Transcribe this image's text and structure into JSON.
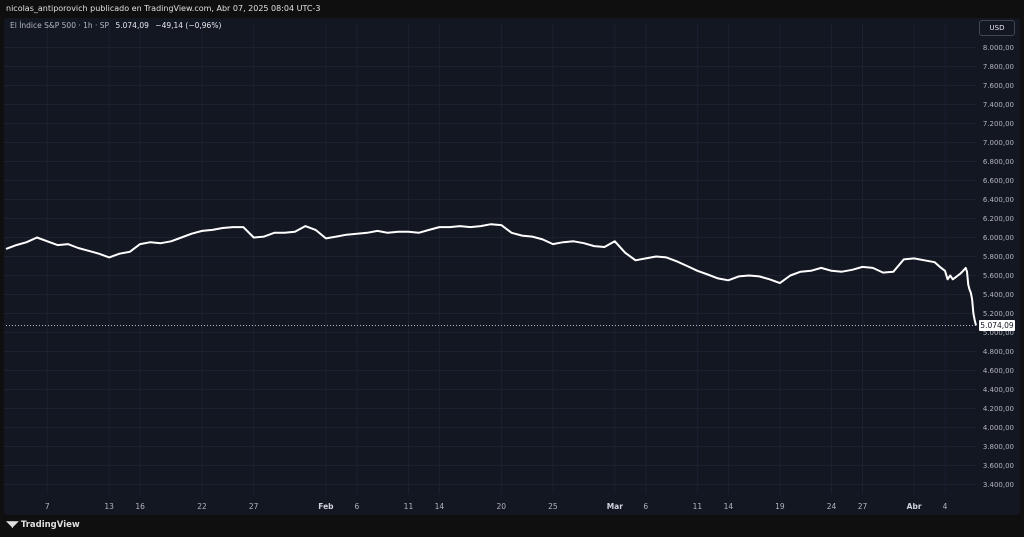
{
  "header": {
    "published_line": "nicolas_antiporovich publicado en TradingView.com, Abr 07, 2025 08:04 UTC-3"
  },
  "legend": {
    "symbol": "El Índice S&P 500 · 1h · SP",
    "last_value": "5.074,09",
    "change": "−49,14 (−0,96%)"
  },
  "toolbar": {
    "currency_label": "USD"
  },
  "footer": {
    "brand": "TradingView",
    "logo_icon": "tradingview-logo-icon"
  },
  "colors": {
    "background": "#131722",
    "line": "#ffffff",
    "grid": "#1e2230",
    "text": "#b2b5be"
  },
  "chart_data": {
    "type": "line",
    "title": "",
    "xlabel": "",
    "ylabel": "",
    "ylim": [
      3300,
      8100
    ],
    "grid": true,
    "y_axis_side": "right",
    "y_ticks": [
      {
        "value": 8000,
        "label": "8.000,00"
      },
      {
        "value": 7800,
        "label": "7.800,00"
      },
      {
        "value": 7600,
        "label": "7.600,00"
      },
      {
        "value": 7400,
        "label": "7.400,00"
      },
      {
        "value": 7200,
        "label": "7.200,00"
      },
      {
        "value": 7000,
        "label": "7.000,00"
      },
      {
        "value": 6800,
        "label": "6.800,00"
      },
      {
        "value": 6600,
        "label": "6.600,00"
      },
      {
        "value": 6400,
        "label": "6.400,00"
      },
      {
        "value": 6200,
        "label": "6.200,00"
      },
      {
        "value": 6000,
        "label": "6.000,00"
      },
      {
        "value": 5800,
        "label": "5.800,00"
      },
      {
        "value": 5600,
        "label": "5.600,00"
      },
      {
        "value": 5400,
        "label": "5.400,00"
      },
      {
        "value": 5200,
        "label": "5.200,00"
      },
      {
        "value": 5000,
        "label": "5.000,00"
      },
      {
        "value": 4800,
        "label": "4.800,00"
      },
      {
        "value": 4600,
        "label": "4.600,00"
      },
      {
        "value": 4400,
        "label": "4.400,00"
      },
      {
        "value": 4200,
        "label": "4.200,00"
      },
      {
        "value": 4000,
        "label": "4.000,00"
      },
      {
        "value": 3800,
        "label": "3.800,00"
      },
      {
        "value": 3600,
        "label": "3.600,00"
      },
      {
        "value": 3400,
        "label": "3.400,00"
      }
    ],
    "x_domain": [
      "2025-01-03",
      "2025-04-07"
    ],
    "x_ticks": [
      {
        "date": "2025-01-07",
        "label": "7",
        "bold": false
      },
      {
        "date": "2025-01-13",
        "label": "13",
        "bold": false
      },
      {
        "date": "2025-01-16",
        "label": "16",
        "bold": false
      },
      {
        "date": "2025-01-22",
        "label": "22",
        "bold": false
      },
      {
        "date": "2025-01-27",
        "label": "27",
        "bold": false
      },
      {
        "date": "2025-02-03",
        "label": "Feb",
        "bold": true
      },
      {
        "date": "2025-02-06",
        "label": "6",
        "bold": false
      },
      {
        "date": "2025-02-11",
        "label": "11",
        "bold": false
      },
      {
        "date": "2025-02-14",
        "label": "14",
        "bold": false
      },
      {
        "date": "2025-02-20",
        "label": "20",
        "bold": false
      },
      {
        "date": "2025-02-25",
        "label": "25",
        "bold": false
      },
      {
        "date": "2025-03-03",
        "label": "Mar",
        "bold": true
      },
      {
        "date": "2025-03-06",
        "label": "6",
        "bold": false
      },
      {
        "date": "2025-03-11",
        "label": "11",
        "bold": false
      },
      {
        "date": "2025-03-14",
        "label": "14",
        "bold": false
      },
      {
        "date": "2025-03-19",
        "label": "19",
        "bold": false
      },
      {
        "date": "2025-03-24",
        "label": "24",
        "bold": false
      },
      {
        "date": "2025-03-27",
        "label": "27",
        "bold": false
      },
      {
        "date": "2025-04-01",
        "label": "Abr",
        "bold": true
      },
      {
        "date": "2025-04-04",
        "label": "4",
        "bold": false
      }
    ],
    "last_price": {
      "value": 5074.09,
      "label": "5.074,09"
    },
    "series": [
      {
        "points": [
          [
            "2025-01-03",
            5880
          ],
          [
            "2025-01-04",
            5920
          ],
          [
            "2025-01-05",
            5950
          ],
          [
            "2025-01-06",
            6000
          ],
          [
            "2025-01-07",
            5960
          ],
          [
            "2025-01-08",
            5920
          ],
          [
            "2025-01-09",
            5930
          ],
          [
            "2025-01-10",
            5890
          ],
          [
            "2025-01-11",
            5860
          ],
          [
            "2025-01-12",
            5830
          ],
          [
            "2025-01-13",
            5790
          ],
          [
            "2025-01-14",
            5830
          ],
          [
            "2025-01-15",
            5850
          ],
          [
            "2025-01-16",
            5930
          ],
          [
            "2025-01-17",
            5950
          ],
          [
            "2025-01-18",
            5940
          ],
          [
            "2025-01-19",
            5960
          ],
          [
            "2025-01-20",
            6000
          ],
          [
            "2025-01-21",
            6040
          ],
          [
            "2025-01-22",
            6070
          ],
          [
            "2025-01-23",
            6080
          ],
          [
            "2025-01-24",
            6100
          ],
          [
            "2025-01-25",
            6110
          ],
          [
            "2025-01-26",
            6110
          ],
          [
            "2025-01-27",
            6000
          ],
          [
            "2025-01-28",
            6010
          ],
          [
            "2025-01-29",
            6050
          ],
          [
            "2025-01-30",
            6050
          ],
          [
            "2025-01-31",
            6060
          ],
          [
            "2025-02-01",
            6120
          ],
          [
            "2025-02-02",
            6080
          ],
          [
            "2025-02-03",
            5990
          ],
          [
            "2025-02-04",
            6010
          ],
          [
            "2025-02-05",
            6030
          ],
          [
            "2025-02-06",
            6040
          ],
          [
            "2025-02-07",
            6050
          ],
          [
            "2025-02-08",
            6070
          ],
          [
            "2025-02-09",
            6050
          ],
          [
            "2025-02-10",
            6060
          ],
          [
            "2025-02-11",
            6060
          ],
          [
            "2025-02-12",
            6050
          ],
          [
            "2025-02-13",
            6080
          ],
          [
            "2025-02-14",
            6110
          ],
          [
            "2025-02-15",
            6110
          ],
          [
            "2025-02-16",
            6120
          ],
          [
            "2025-02-17",
            6110
          ],
          [
            "2025-02-18",
            6120
          ],
          [
            "2025-02-19",
            6140
          ],
          [
            "2025-02-20",
            6130
          ],
          [
            "2025-02-21",
            6050
          ],
          [
            "2025-02-22",
            6020
          ],
          [
            "2025-02-23",
            6010
          ],
          [
            "2025-02-24",
            5980
          ],
          [
            "2025-02-25",
            5930
          ],
          [
            "2025-02-26",
            5950
          ],
          [
            "2025-02-27",
            5960
          ],
          [
            "2025-02-28",
            5940
          ],
          [
            "2025-03-01",
            5910
          ],
          [
            "2025-03-02",
            5900
          ],
          [
            "2025-03-03",
            5960
          ],
          [
            "2025-03-04",
            5840
          ],
          [
            "2025-03-05",
            5760
          ],
          [
            "2025-03-06",
            5780
          ],
          [
            "2025-03-07",
            5800
          ],
          [
            "2025-03-08",
            5790
          ],
          [
            "2025-03-09",
            5750
          ],
          [
            "2025-03-10",
            5700
          ],
          [
            "2025-03-11",
            5650
          ],
          [
            "2025-03-12",
            5610
          ],
          [
            "2025-03-13",
            5570
          ],
          [
            "2025-03-14",
            5550
          ],
          [
            "2025-03-15",
            5590
          ],
          [
            "2025-03-16",
            5600
          ],
          [
            "2025-03-17",
            5590
          ],
          [
            "2025-03-18",
            5560
          ],
          [
            "2025-03-19",
            5520
          ],
          [
            "2025-03-20",
            5600
          ],
          [
            "2025-03-21",
            5640
          ],
          [
            "2025-03-22",
            5650
          ],
          [
            "2025-03-23",
            5680
          ],
          [
            "2025-03-24",
            5650
          ],
          [
            "2025-03-25",
            5640
          ],
          [
            "2025-03-26",
            5660
          ],
          [
            "2025-03-27",
            5690
          ],
          [
            "2025-03-28",
            5680
          ],
          [
            "2025-03-29",
            5630
          ],
          [
            "2025-03-30",
            5640
          ],
          [
            "2025-03-31",
            5770
          ],
          [
            "2025-04-01",
            5780
          ],
          [
            "2025-04-02",
            5760
          ],
          [
            "2025-04-03",
            5740
          ],
          [
            "2025-04-03T12:00",
            5690
          ],
          [
            "2025-04-04",
            5650
          ],
          [
            "2025-04-04T06:00",
            5560
          ],
          [
            "2025-04-04T12:00",
            5600
          ],
          [
            "2025-04-04T18:00",
            5560
          ],
          [
            "2025-04-05",
            5580
          ],
          [
            "2025-04-05T06:00",
            5600
          ],
          [
            "2025-04-05T12:00",
            5620
          ],
          [
            "2025-04-05T18:00",
            5650
          ],
          [
            "2025-04-06",
            5680
          ],
          [
            "2025-04-06T03:00",
            5640
          ],
          [
            "2025-04-06T06:00",
            5500
          ],
          [
            "2025-04-06T09:00",
            5450
          ],
          [
            "2025-04-06T12:00",
            5420
          ],
          [
            "2025-04-06T15:00",
            5350
          ],
          [
            "2025-04-06T18:00",
            5200
          ],
          [
            "2025-04-06T21:00",
            5130
          ],
          [
            "2025-04-07",
            5074.09
          ]
        ]
      }
    ]
  }
}
